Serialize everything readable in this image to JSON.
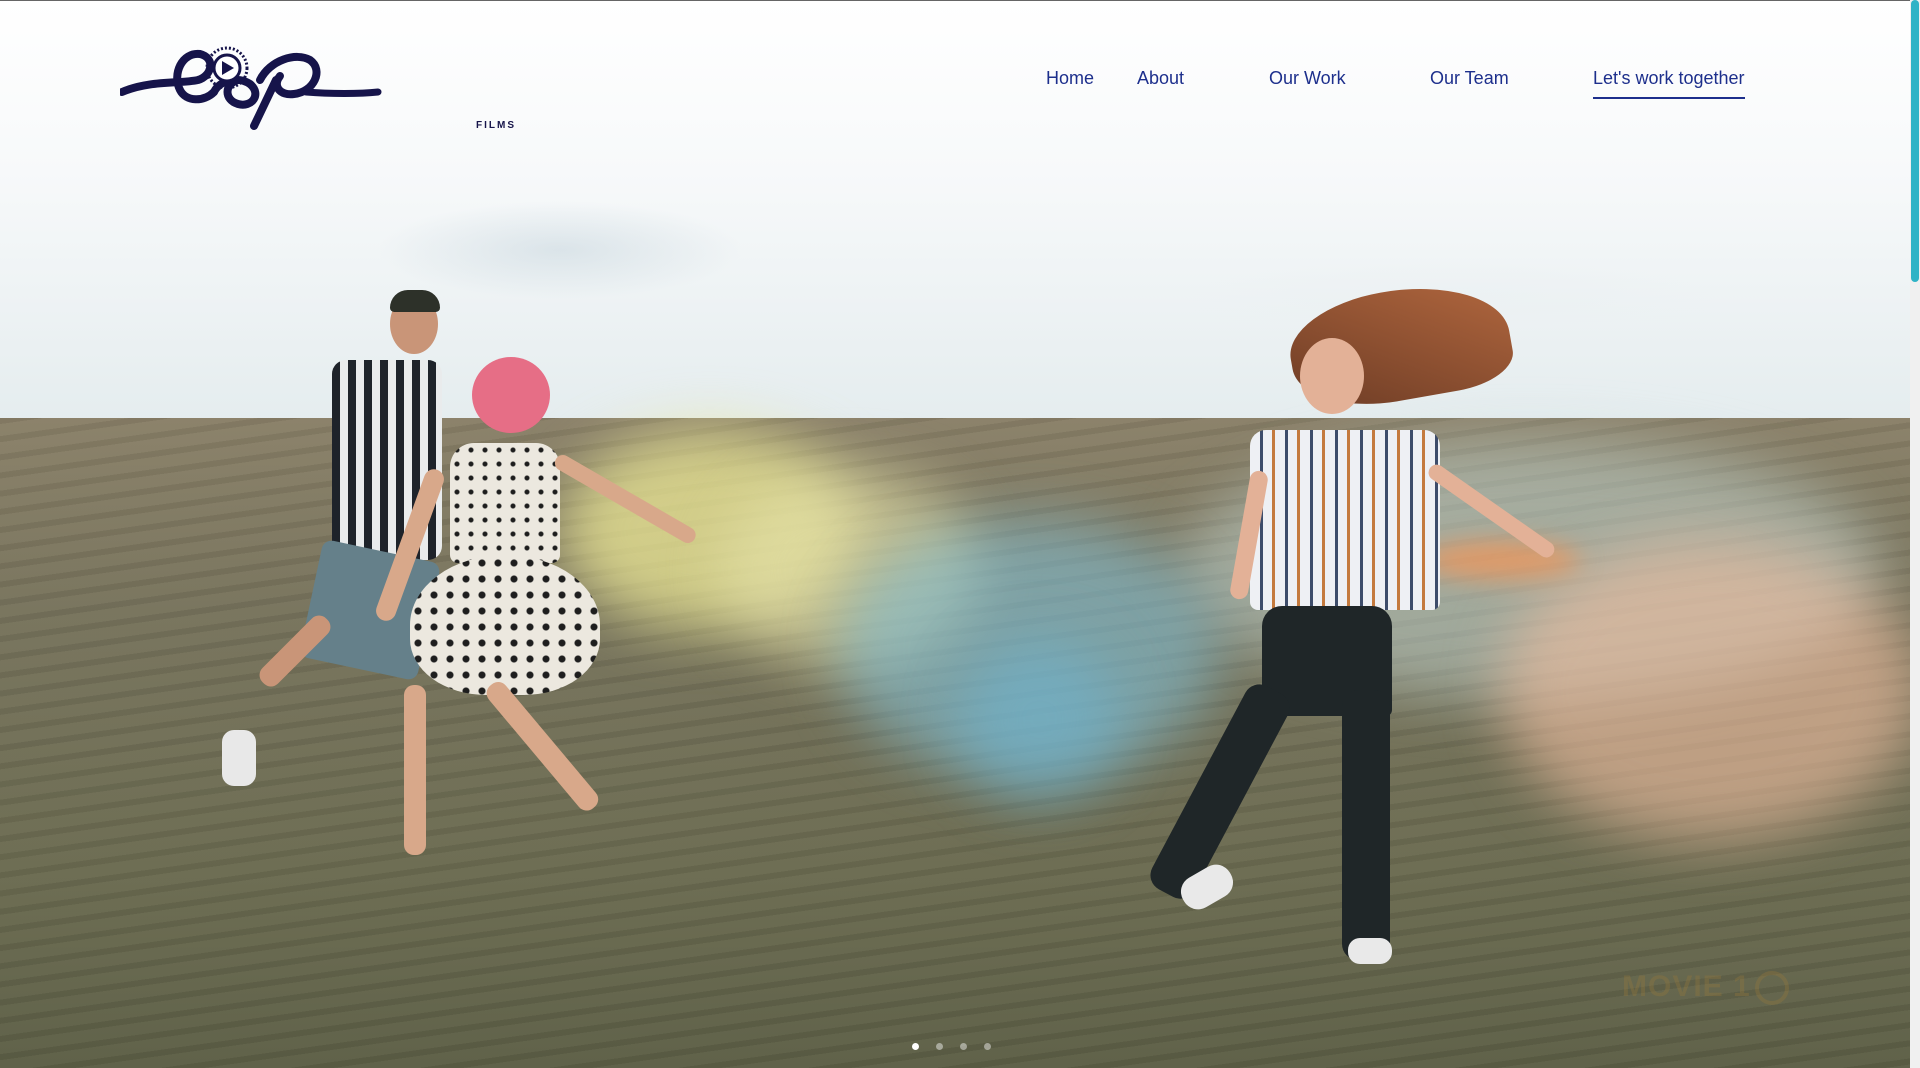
{
  "brand": {
    "logo_sub": "FILMS"
  },
  "nav": {
    "items": [
      {
        "label": "Home"
      },
      {
        "label": "About"
      },
      {
        "label": "Our Work"
      },
      {
        "label": "Our Team"
      }
    ],
    "cta_label": "Let's work together"
  },
  "hero": {
    "watermark": "MOVIE 1",
    "carousel": {
      "total": 4,
      "active_index": 0
    }
  },
  "colors": {
    "nav_text": "#1d2f8c",
    "logo": "#16144a",
    "scrollbar_thumb": "#2fb3c6"
  },
  "icons": {
    "logo_mark": "play-reel-icon"
  }
}
